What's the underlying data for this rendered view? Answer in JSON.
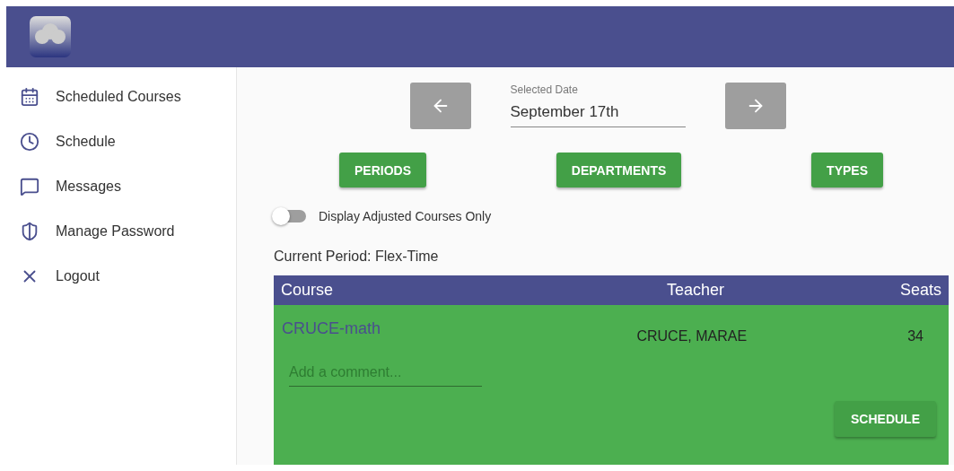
{
  "sidebar": {
    "items": [
      {
        "label": "Scheduled Courses"
      },
      {
        "label": "Schedule"
      },
      {
        "label": "Messages"
      },
      {
        "label": "Manage Password"
      },
      {
        "label": "Logout"
      }
    ]
  },
  "date_picker": {
    "label": "Selected Date",
    "value": "September 17th"
  },
  "filters": [
    "PERIODS",
    "DEPARTMENTS",
    "TYPES"
  ],
  "toggle": {
    "label": "Display Adjusted Courses Only",
    "on": false
  },
  "current_period": "Current Period: Flex-Time",
  "table": {
    "columns": [
      "Course",
      "Teacher",
      "Seats"
    ],
    "rows": [
      {
        "course": "CRUCE-math",
        "teacher": "CRUCE, MARAE",
        "seats": "34",
        "comment": {
          "placeholder": "Add a comment..."
        },
        "button": "SCHEDULE"
      }
    ]
  }
}
